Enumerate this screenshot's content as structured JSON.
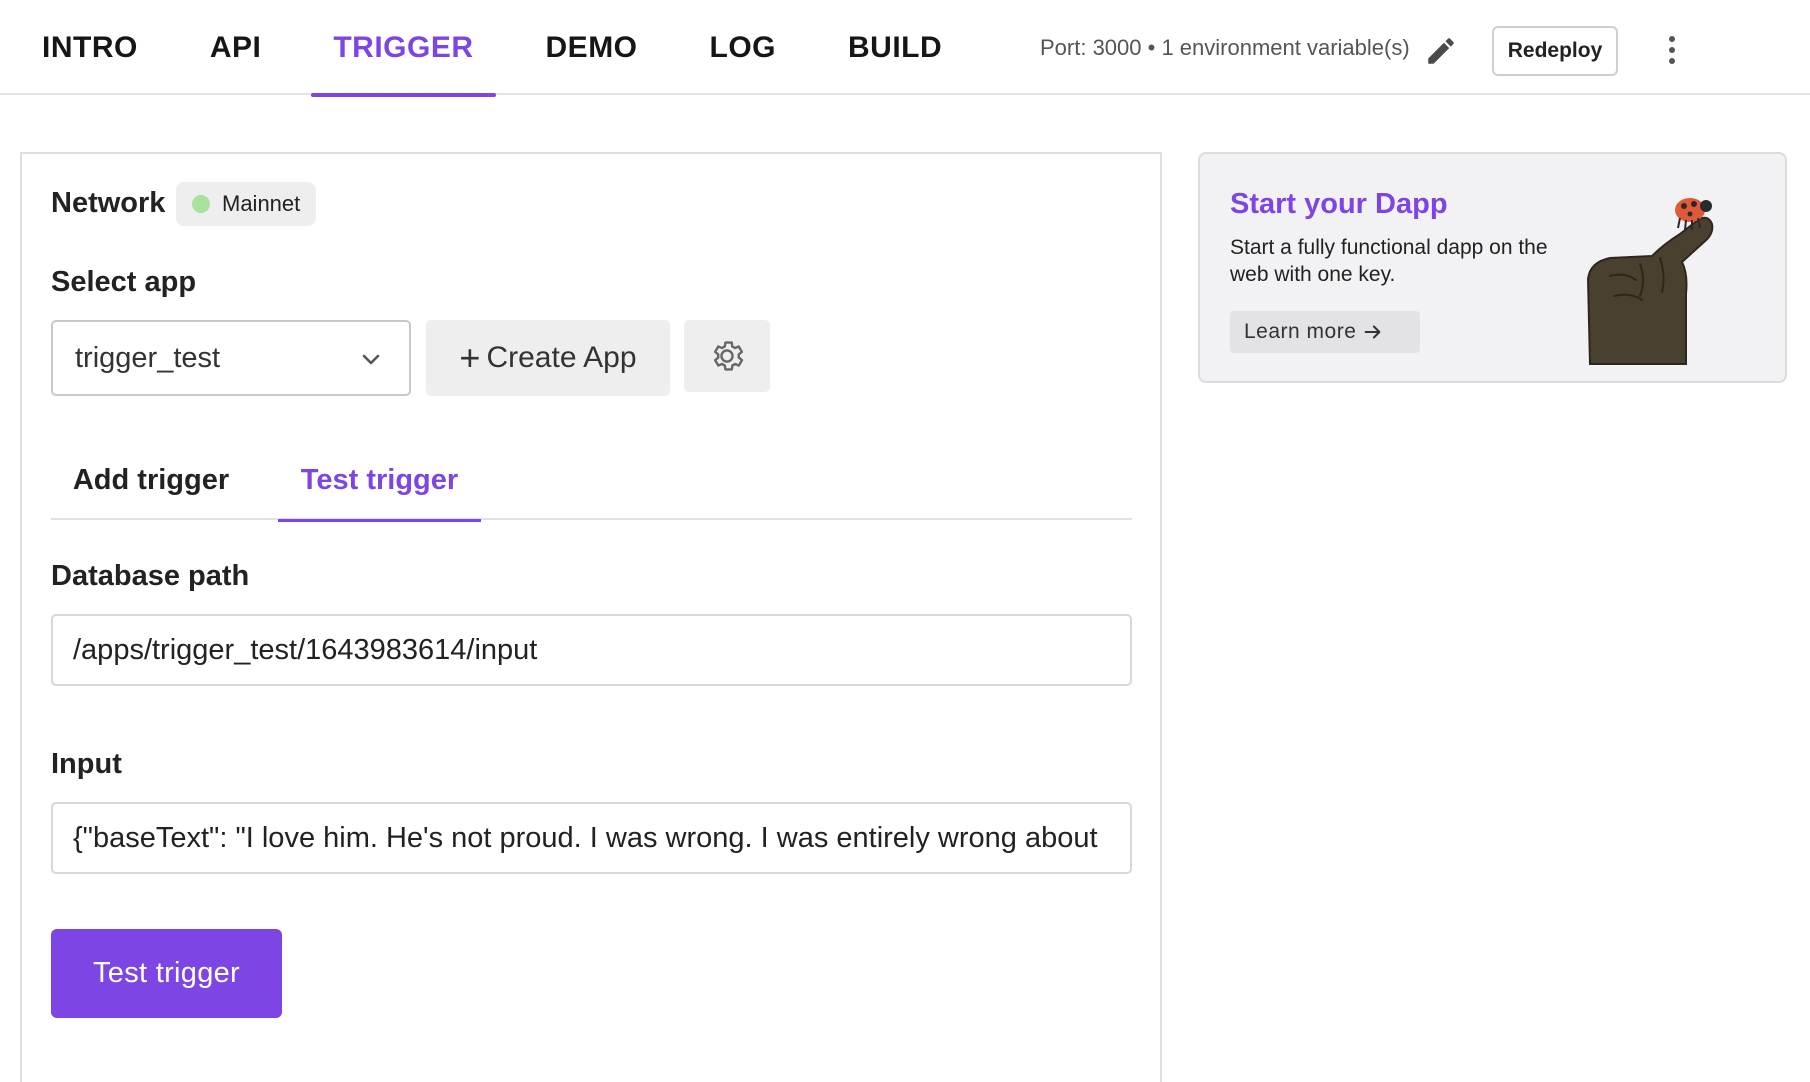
{
  "nav": {
    "tabs": [
      {
        "label": "INTRO",
        "active": false
      },
      {
        "label": "API",
        "active": false
      },
      {
        "label": "TRIGGER",
        "active": true
      },
      {
        "label": "DEMO",
        "active": false
      },
      {
        "label": "LOG",
        "active": false
      },
      {
        "label": "BUILD",
        "active": false
      }
    ],
    "env_info": "Port: 3000 • 1 environment variable(s)",
    "redeploy_label": "Redeploy",
    "edit_icon": "pencil-icon",
    "menu_icon": "more-vertical-icon"
  },
  "network": {
    "label": "Network",
    "value": "Mainnet",
    "status_color": "#a9e29a"
  },
  "select_app": {
    "label": "Select app",
    "selected": "trigger_test",
    "create_label": "Create App",
    "settings_icon": "gear-icon"
  },
  "subtabs": [
    {
      "label": "Add trigger",
      "active": false
    },
    {
      "label": "Test trigger",
      "active": true
    }
  ],
  "form": {
    "db_path_label": "Database path",
    "db_path_value": "/apps/trigger_test/1643983614/input",
    "input_label": "Input",
    "input_value": "{\"baseText\": \"I love him. He's not proud. I was wrong. I was entirely wrong about",
    "submit_label": "Test trigger"
  },
  "promo": {
    "title": "Start your Dapp",
    "description": "Start a fully functional dapp on the web with one key.",
    "link_label": "Learn more"
  },
  "colors": {
    "accent": "#7d45e3",
    "border": "#dedede",
    "muted_bg": "#eeeeee"
  }
}
